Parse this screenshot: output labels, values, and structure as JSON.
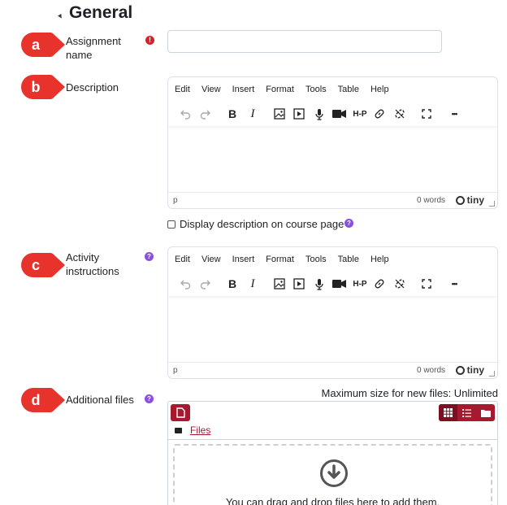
{
  "section": {
    "title": "General"
  },
  "callouts": [
    "a",
    "b",
    "c",
    "d"
  ],
  "fields": {
    "assignment_name": {
      "label": "Assignment name",
      "value": ""
    },
    "description": {
      "label": "Description"
    },
    "activity_instructions": {
      "label": "Activity instructions"
    },
    "additional_files": {
      "label": "Additional files"
    }
  },
  "editor": {
    "menu": [
      "Edit",
      "View",
      "Insert",
      "Format",
      "Tools",
      "Table",
      "Help"
    ],
    "toolbar_icons": [
      "undo-icon",
      "redo-icon",
      "bold-icon",
      "italic-icon",
      "image-icon",
      "media-icon",
      "microphone-icon",
      "video-camera-icon",
      "h5p-icon",
      "link-icon",
      "unlink-icon",
      "fullscreen-icon",
      "more-icon"
    ],
    "bold_glyph": "B",
    "italic_glyph": "I",
    "h5p_label": "H-P",
    "more_glyph": "•••",
    "status_path": "p",
    "word_count": "0 words",
    "brand": "tiny"
  },
  "display_description": {
    "label": "Display description on course page",
    "checked": false
  },
  "files": {
    "max_size": "Maximum size for new files: Unlimited",
    "path_label": "Files",
    "drop_message": "You can drag and drop files here to add them."
  },
  "colors": {
    "callout": "#e8322c",
    "required": "#d1232a",
    "help": "#8a4fdb",
    "brand": "#a6192e"
  }
}
